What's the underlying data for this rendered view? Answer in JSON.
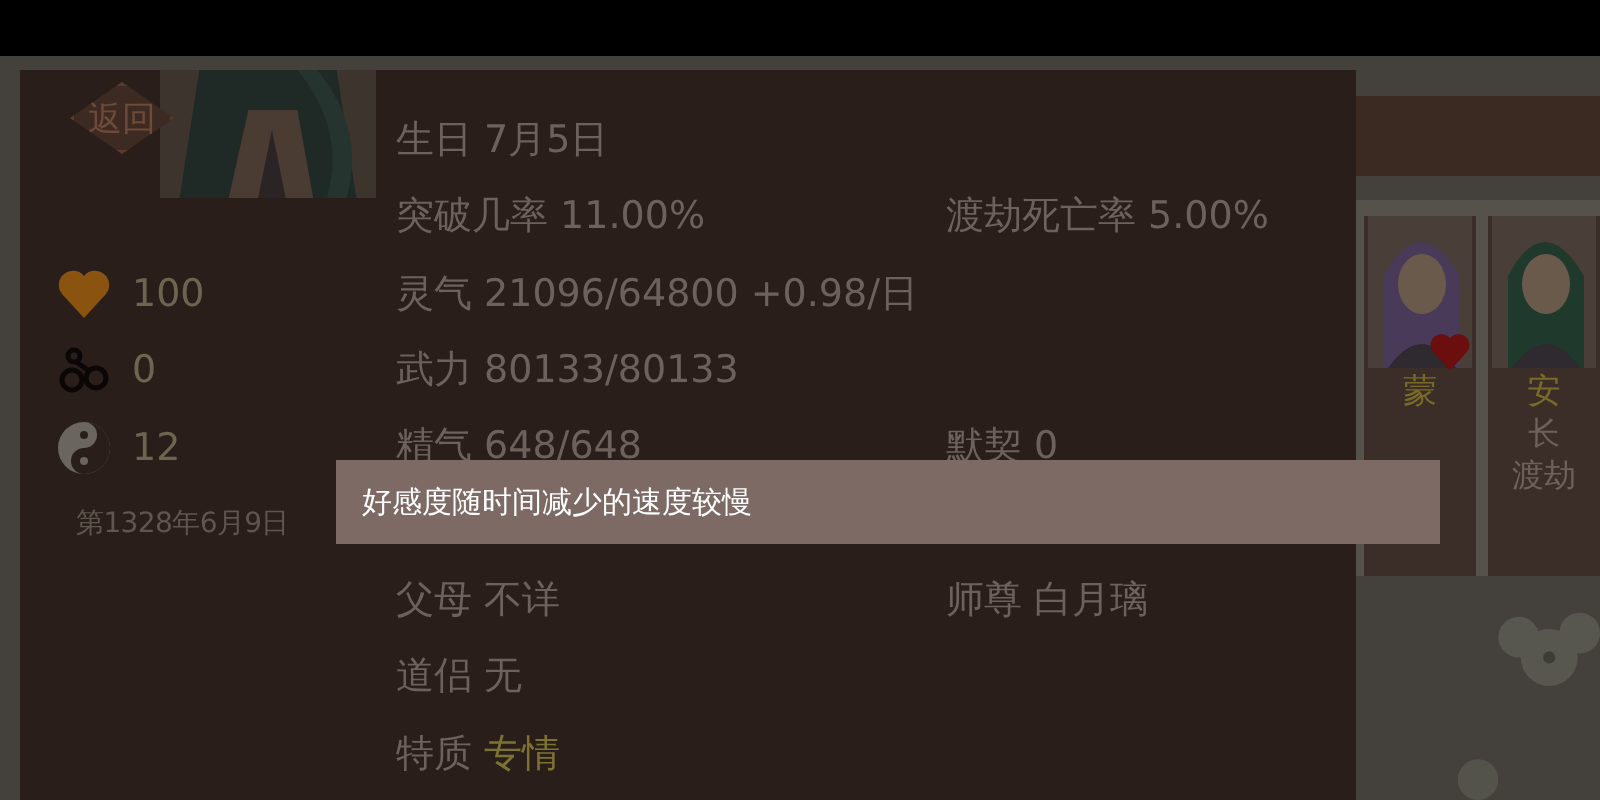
{
  "back_button": {
    "label": "返回"
  },
  "stats": [
    {
      "kind": "heart",
      "value": "100"
    },
    {
      "kind": "cuffs",
      "value": "0"
    },
    {
      "kind": "yinyang",
      "value": "12"
    }
  ],
  "date": "第1328年6月9日",
  "info_rows": [
    {
      "cells": [
        {
          "label": "生日",
          "value": "7月5日",
          "highlighted": false
        }
      ]
    },
    {
      "cells": [
        {
          "label": "突破几率",
          "value": "11.00%",
          "highlighted": false
        },
        {
          "label": "渡劫死亡率",
          "value": "5.00%",
          "highlighted": false
        }
      ]
    },
    {
      "cells": [
        {
          "label": "灵气",
          "value": "21096/64800 +0.98/日",
          "highlighted": false
        }
      ]
    },
    {
      "cells": [
        {
          "label": "武力",
          "value": "80133/80133",
          "highlighted": false
        }
      ]
    },
    {
      "cells": [
        {
          "label": "精气",
          "value": "648/648",
          "highlighted": false
        },
        {
          "label": "默契",
          "value": "0",
          "highlighted": false
        }
      ]
    },
    {
      "cells": []
    },
    {
      "cells": [
        {
          "label": "父母",
          "value": "不详",
          "highlighted": false
        },
        {
          "label": "师尊",
          "value": "白月璃",
          "highlighted": false
        }
      ]
    },
    {
      "cells": [
        {
          "label": "道侣",
          "value": "无",
          "highlighted": false
        }
      ]
    },
    {
      "cells": [
        {
          "label": "特质",
          "value": "专情",
          "highlighted": true
        }
      ]
    }
  ],
  "tooltip": "好感度随时间减少的速度较慢",
  "cards": [
    {
      "name": "蒙",
      "favorite": true
    },
    {
      "name": "安",
      "lines": [
        "长",
        "渡劫"
      ],
      "favorite": false
    }
  ]
}
